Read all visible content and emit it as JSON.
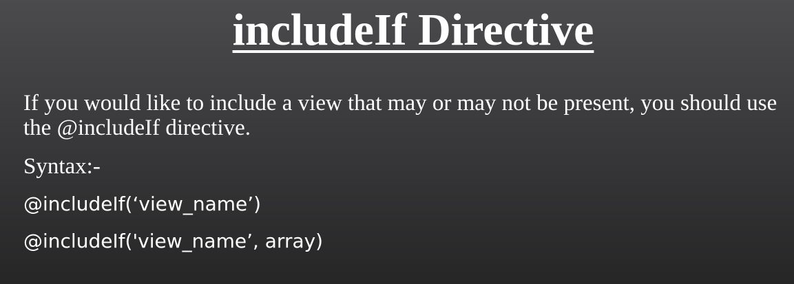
{
  "slide": {
    "title": "includeIf Directive",
    "description": "If you would like to include a view that may or may not be present, you should use the @includeIf directive.",
    "syntax_label": "Syntax:-",
    "code_lines": [
      "@includeIf(‘view_name’)",
      "@includeIf('view_name’, array)"
    ]
  }
}
